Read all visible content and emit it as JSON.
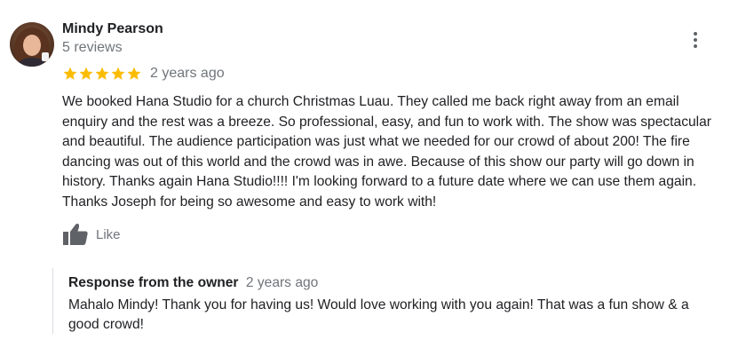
{
  "review": {
    "reviewer_name": "Mindy Pearson",
    "reviewer_meta": "5 reviews",
    "rating": 5,
    "rating_max": 5,
    "date": "2 years ago",
    "text_lines": [
      "We booked Hana Studio for a church Christmas Luau. They called me back right away from an email",
      "enquiry and the rest was a breeze. So professional, easy, and fun to work with. The show was spectacular",
      "and  beautiful.  The audience participation was just what we needed for our crowd of about 200! The fire",
      "dancing was out of this world and the crowd was in awe. Because of this show our party will go down in",
      "history. Thanks again Hana Studio!!!! I'm looking forward to a future date where we can use them again.",
      "Thanks Joseph for being so awesome and easy to work with!"
    ],
    "like_label": "Like",
    "icons": {
      "avatar": "avatar-photo",
      "more": "more-vert-icon",
      "star": "star-icon",
      "like": "thumbs-up-icon"
    },
    "colors": {
      "star": "#fbbc04",
      "secondary_text": "#70757a",
      "primary_text": "#202124",
      "icon": "#5f6368"
    }
  },
  "owner_response": {
    "title": "Response from the owner",
    "date": "2 years ago",
    "text_lines": [
      "Mahalo Mindy! Thank you for having us! Would love working with you again! That was a fun show & a",
      "good crowd!"
    ]
  }
}
